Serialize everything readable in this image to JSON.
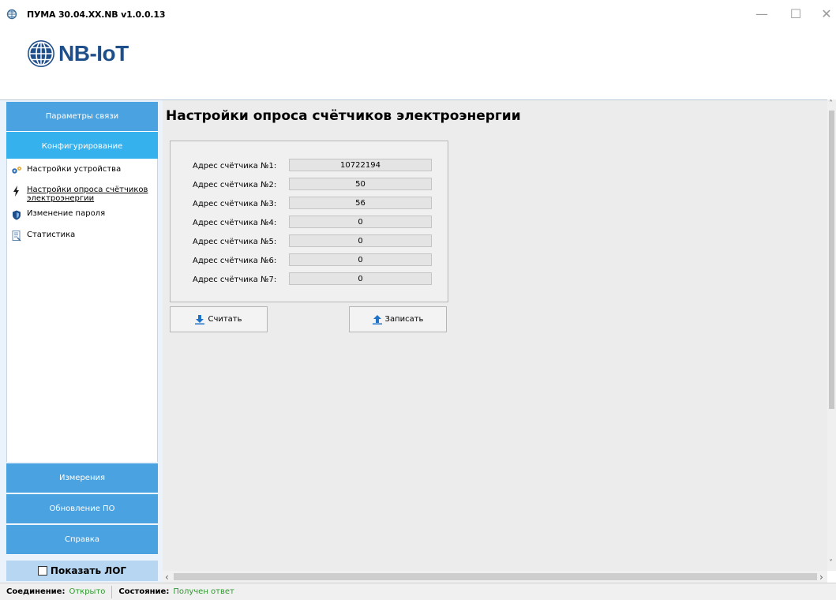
{
  "window": {
    "title": "ПУМА 30.04.XX.NB v1.0.0.13",
    "minimize": "—",
    "maximize": "☐",
    "close": "✕"
  },
  "logo": {
    "text": "NB-IoT",
    "icon": "globe-icon"
  },
  "sidebar": {
    "sections_top": [
      {
        "label": "Параметры связи"
      },
      {
        "label": "Конфигурирование"
      }
    ],
    "items": [
      {
        "label": "Настройки устройства",
        "icon": "gears-icon"
      },
      {
        "label": "Настройки опроса счётчиков электроэнергии",
        "line1": "Настройки опроса счётчиков",
        "line2": "электроэнергии",
        "icon": "lightning-icon"
      },
      {
        "label": "Изменение пароля",
        "icon": "shield-icon"
      },
      {
        "label": "Статистика",
        "icon": "document-icon"
      }
    ],
    "sections_bottom": [
      {
        "label": "Измерения"
      },
      {
        "label": "Обновление ПО"
      },
      {
        "label": "Справка"
      }
    ],
    "show_log": "Показать ЛОГ"
  },
  "main": {
    "title": "Настройки опроса счётчиков электроэнергии",
    "meters": [
      {
        "label": "Адрес счётчика №1:",
        "value": "10722194"
      },
      {
        "label": "Адрес счётчика №2:",
        "value": "50"
      },
      {
        "label": "Адрес счётчика №3:",
        "value": "56"
      },
      {
        "label": "Адрес счётчика №4:",
        "value": "0"
      },
      {
        "label": "Адрес счётчика №5:",
        "value": "0"
      },
      {
        "label": "Адрес счётчика №6:",
        "value": "0"
      },
      {
        "label": "Адрес счётчика №7:",
        "value": "0"
      }
    ],
    "read_button": "Считать",
    "write_button": "Записать"
  },
  "status": {
    "connection_key": "Соединение:",
    "connection_value": "Открыто",
    "state_key": "Состояние:",
    "state_value": "Получен ответ"
  },
  "colors": {
    "sidebar_header": "#4aa3e0",
    "sidebar_active": "#35b1ee",
    "logo_text": "#1f4f8a",
    "status_ok": "#2e9a2e"
  }
}
